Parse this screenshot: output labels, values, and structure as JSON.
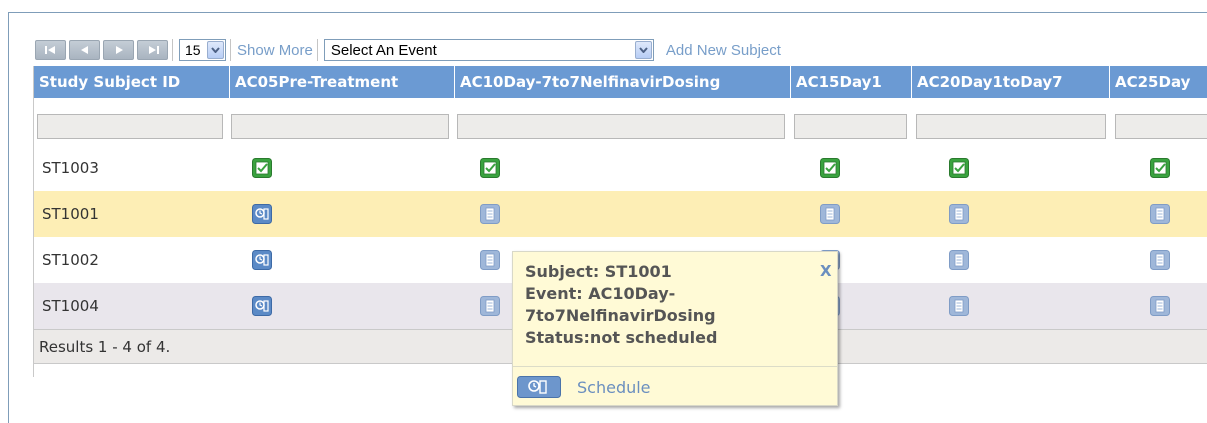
{
  "toolbar": {
    "pager_buttons": [
      "first-page-icon",
      "prev-page-icon",
      "next-page-icon",
      "last-page-icon"
    ],
    "page_size": "15",
    "show_more": "Show More",
    "event_select": "Select An Event",
    "add_subject": "Add New Subject"
  },
  "columns": [
    "Study Subject ID",
    "AC05Pre-Treatment",
    "AC10Day-7to7NelfinavirDosing",
    "AC15Day1",
    "AC20Day1toDay7",
    "AC25Day"
  ],
  "rows": [
    {
      "id": "ST1003",
      "statuses": [
        "completed",
        "completed",
        "completed",
        "completed",
        "completed"
      ]
    },
    {
      "id": "ST1001",
      "statuses": [
        "scheduled",
        "not-scheduled",
        "not-scheduled",
        "not-scheduled",
        "not-scheduled"
      ]
    },
    {
      "id": "ST1002",
      "statuses": [
        "scheduled",
        "not-scheduled",
        "not-scheduled",
        "not-scheduled",
        "not-scheduled"
      ]
    },
    {
      "id": "ST1004",
      "statuses": [
        "scheduled",
        "not-scheduled",
        "not-scheduled",
        "not-scheduled",
        "not-scheduled"
      ]
    }
  ],
  "footer": "Results 1 - 4 of 4.",
  "popup": {
    "line1": "Subject: ST1001",
    "line2": "Event: AC10Day-",
    "line3": "7to7NelfinavirDosing",
    "line4": "Status:not scheduled",
    "close": "X",
    "action": "Schedule"
  },
  "colors": {
    "header_bg": "#6b9ad3",
    "row_highlight": "#fdeeb5",
    "row_alt": "#e9e6ec",
    "completed_green": "#3aa33f",
    "scheduled_blue": "#5b8ac6",
    "not_scheduled_blue": "#9fb7d9",
    "popup_bg": "#fffad6",
    "link": "#789ec9"
  }
}
